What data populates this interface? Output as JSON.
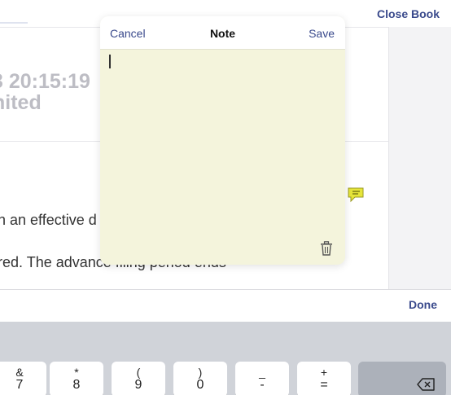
{
  "header": {
    "close_book_label": "Close Book"
  },
  "document": {
    "timestamp_fragment": "3 20:15:19",
    "status_fragment": "nited",
    "line1": "n an effective d",
    "line2": "red. The advance filing period ends"
  },
  "note_dialog": {
    "cancel_label": "Cancel",
    "title": "Note",
    "save_label": "Save",
    "text_value": ""
  },
  "accessory_bar": {
    "done_label": "Done"
  },
  "keyboard": {
    "keys": [
      {
        "top": "&",
        "bottom": "7"
      },
      {
        "top": "*",
        "bottom": "8"
      },
      {
        "top": "(",
        "bottom": "9"
      },
      {
        "top": ")",
        "bottom": "0"
      },
      {
        "top": "_",
        "bottom": "-"
      },
      {
        "top": "+",
        "bottom": "="
      }
    ]
  },
  "colors": {
    "accent": "#3a4a8c",
    "note_background": "#f4f4dc",
    "note_marker": "#e6e53a",
    "keyboard_background": "#d0d3d9"
  },
  "icons": {
    "note_marker": "note-marker-icon",
    "trash": "trash-icon",
    "delete": "backspace-icon"
  }
}
